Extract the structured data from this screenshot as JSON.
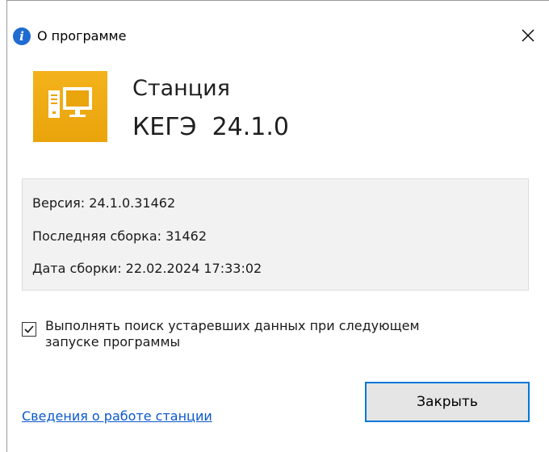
{
  "window": {
    "title": "О программе",
    "icon": "info-icon",
    "close_icon": "close-icon"
  },
  "product": {
    "icon": "computer-station-icon",
    "name": "Станция",
    "version_title": "КЕГЭ  24.1.0",
    "tile_color": "#f0ab14"
  },
  "info": {
    "version": "Версия: 24.1.0.31462",
    "last_build": "Последняя сборка: 31462",
    "build_date": "Дата сборки: 22.02.2024 17:33:02"
  },
  "option": {
    "checked": true,
    "label": "Выполнять поиск устаревших данных при следующем запуске программы"
  },
  "footer": {
    "link_label": "Сведения о работе станции",
    "close_label": "Закрыть",
    "accent_color": "#0078d7",
    "link_color": "#0a58ca"
  }
}
